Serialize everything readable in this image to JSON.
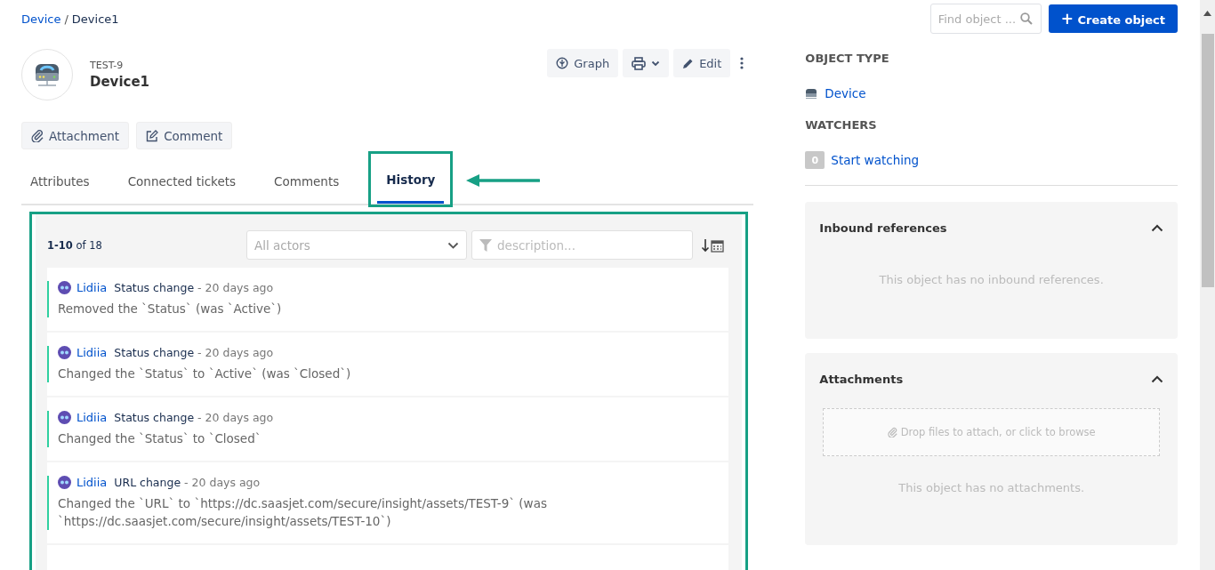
{
  "breadcrumb": {
    "parent": "Device",
    "separator": "/",
    "current": "Device1"
  },
  "search": {
    "placeholder": "Find object ..."
  },
  "create_button": {
    "icon": "+",
    "label": "Create object"
  },
  "object": {
    "key": "TEST-9",
    "name": "Device1"
  },
  "header_actions": [
    {
      "kind": "text",
      "label": "Graph"
    },
    {
      "kind": "print"
    },
    {
      "kind": "text",
      "label": "Edit"
    },
    {
      "kind": "more"
    }
  ],
  "quick_actions": [
    {
      "kind": "attach",
      "label": "Attachment"
    },
    {
      "kind": "comment",
      "label": "Comment"
    }
  ],
  "tabs": [
    {
      "label": "Attributes",
      "selected": false
    },
    {
      "label": "Connected tickets",
      "selected": false
    },
    {
      "label": "Comments",
      "selected": false
    },
    {
      "label": "History",
      "selected": true
    }
  ],
  "history": {
    "range": "**1-10** of 18",
    "actor_filter": {
      "placeholder": "All actors"
    },
    "description_filter": {
      "placeholder": "description..."
    },
    "entries": [
      {
        "user": "Lidiia",
        "type": "Status change",
        "time": "- 20 days ago",
        "text": "Removed the `Status` (was `Active`)"
      },
      {
        "user": "Lidiia",
        "type": "Status change",
        "time": "- 20 days ago",
        "text": "Changed the `Status` to `Active` (was `Closed`)"
      },
      {
        "user": "Lidiia",
        "type": "Status change",
        "time": "- 20 days ago",
        "text": "Changed the `Status` to `Closed`"
      },
      {
        "user": "Lidiia",
        "type": "URL change",
        "time": "- 20 days ago",
        "text": "Changed the `URL` to `https://dc.saasjet.com/secure/insight/assets/TEST-9` (was `https://dc.saasjet.com/secure/insight/assets/TEST-10`)"
      }
    ]
  },
  "sidebar": {
    "object_type_heading": "OBJECT TYPE",
    "object_type": "Device",
    "watchers_heading": "WATCHERS",
    "watchers_count": "0",
    "watch_link": "Start watching",
    "inbound": {
      "title": "Inbound references",
      "expanded": true,
      "empty": "This object has no inbound references."
    },
    "attachments": {
      "title": "Attachments",
      "expanded": true,
      "dropzone": "Drop files to attach, or click to browse",
      "empty": "This object has no attachments."
    }
  }
}
